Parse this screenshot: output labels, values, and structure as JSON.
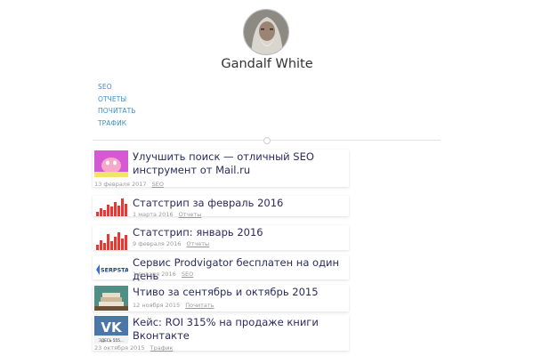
{
  "profile": {
    "name": "Gandalf White"
  },
  "nav": {
    "items": [
      "SEO",
      "ОТЧЕТЫ",
      "ПОЧИТАТЬ",
      "ТРАФИК"
    ]
  },
  "posts": [
    {
      "title": "Улучшить поиск — отличный SEO инструмент от Mail.ru",
      "date": "13 февраля 2017",
      "category": "SEO"
    },
    {
      "title": "Статстрип за февраль 2016",
      "date": "1 марта 2016",
      "category": "Отчеты"
    },
    {
      "title": "Статстрип: январь 2016",
      "date": "9 февраля 2016",
      "category": "Отчеты"
    },
    {
      "title": "Сервис Prodvigator бесплатен на один день",
      "date": "1 января 2016",
      "category": "SEO"
    },
    {
      "title": "Чтиво за сентябрь и октябрь 2015",
      "date": "12 ноября 2015",
      "category": "Почитать"
    },
    {
      "title": "Кейс: ROI 315% на продаже книги Вконтакте",
      "date": "23 октября 2015",
      "category": "Трафик"
    }
  ],
  "thumbs": {
    "serpstat_text": "SERPSTAT",
    "vk_logo": "VK",
    "vk_caption": "ЗДЕСЬ 555..."
  }
}
